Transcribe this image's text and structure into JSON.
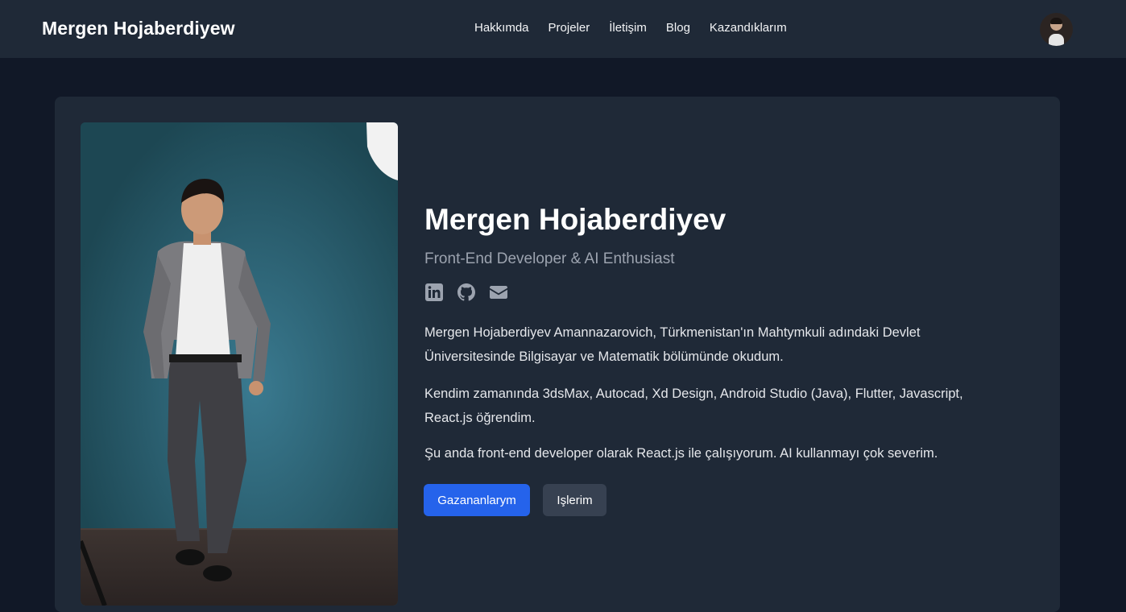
{
  "header": {
    "brand": "Mergen Hojaberdiyew",
    "nav": [
      "Hakkımda",
      "Projeler",
      "İletişim",
      "Blog",
      "Kazandıklarım"
    ],
    "avatar_icon": "profile-avatar"
  },
  "hero": {
    "name": "Mergen Hojaberdiyev",
    "subtitle": "Front-End Developer & AI Enthusiast",
    "socials": [
      "linkedin-icon",
      "github-icon",
      "email-icon"
    ],
    "paragraphs": [
      "Mergen Hojaberdiyev Amannazarovich, Türkmenistan'ın Mahtymkuli adındaki Devlet Üniversitesinde Bilgisayar ve Matematik bölümünde okudum.",
      "Kendim zamanında 3dsMax, Autocad, Xd Design, Android Studio (Java), Flutter, Javascript, React.js öğrendim.",
      "Şu anda front-end developer olarak React.js ile çalışıyorum. AI kullanmayı çok severim."
    ],
    "primary_button": "Gazananlarym",
    "secondary_button": "Işlerim"
  },
  "colors": {
    "page_bg": "#111827",
    "surface": "#1f2937",
    "accent": "#2563eb",
    "muted": "#9ca3af"
  }
}
